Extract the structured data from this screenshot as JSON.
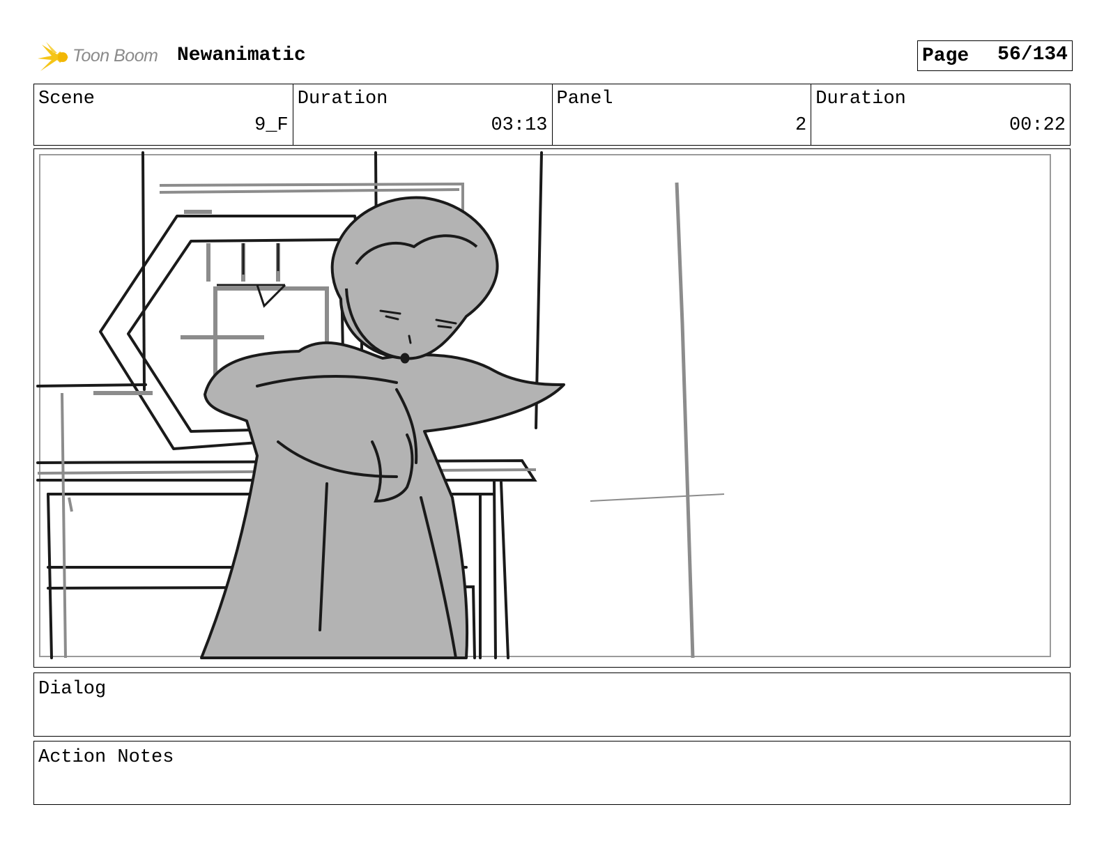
{
  "header": {
    "logo_text": "Toon Boom",
    "project_title": "Newanimatic",
    "page_label": "Page",
    "page_value": "56/134"
  },
  "info": {
    "scene_label": "Scene",
    "scene_value": "9_F",
    "scene_duration_label": "Duration",
    "scene_duration_value": "03:13",
    "panel_label": "Panel",
    "panel_value": "2",
    "panel_duration_label": "Duration",
    "panel_duration_value": "00:22"
  },
  "dialog": {
    "label": "Dialog",
    "text": ""
  },
  "action_notes": {
    "label": "Action Notes",
    "text": ""
  },
  "icons": {
    "logo": "toon-boom-star-logo"
  },
  "colors": {
    "logo_yellow": "#f5c518",
    "sketch_fill": "#b3b3b3",
    "sketch_line": "#1a1a1a"
  }
}
